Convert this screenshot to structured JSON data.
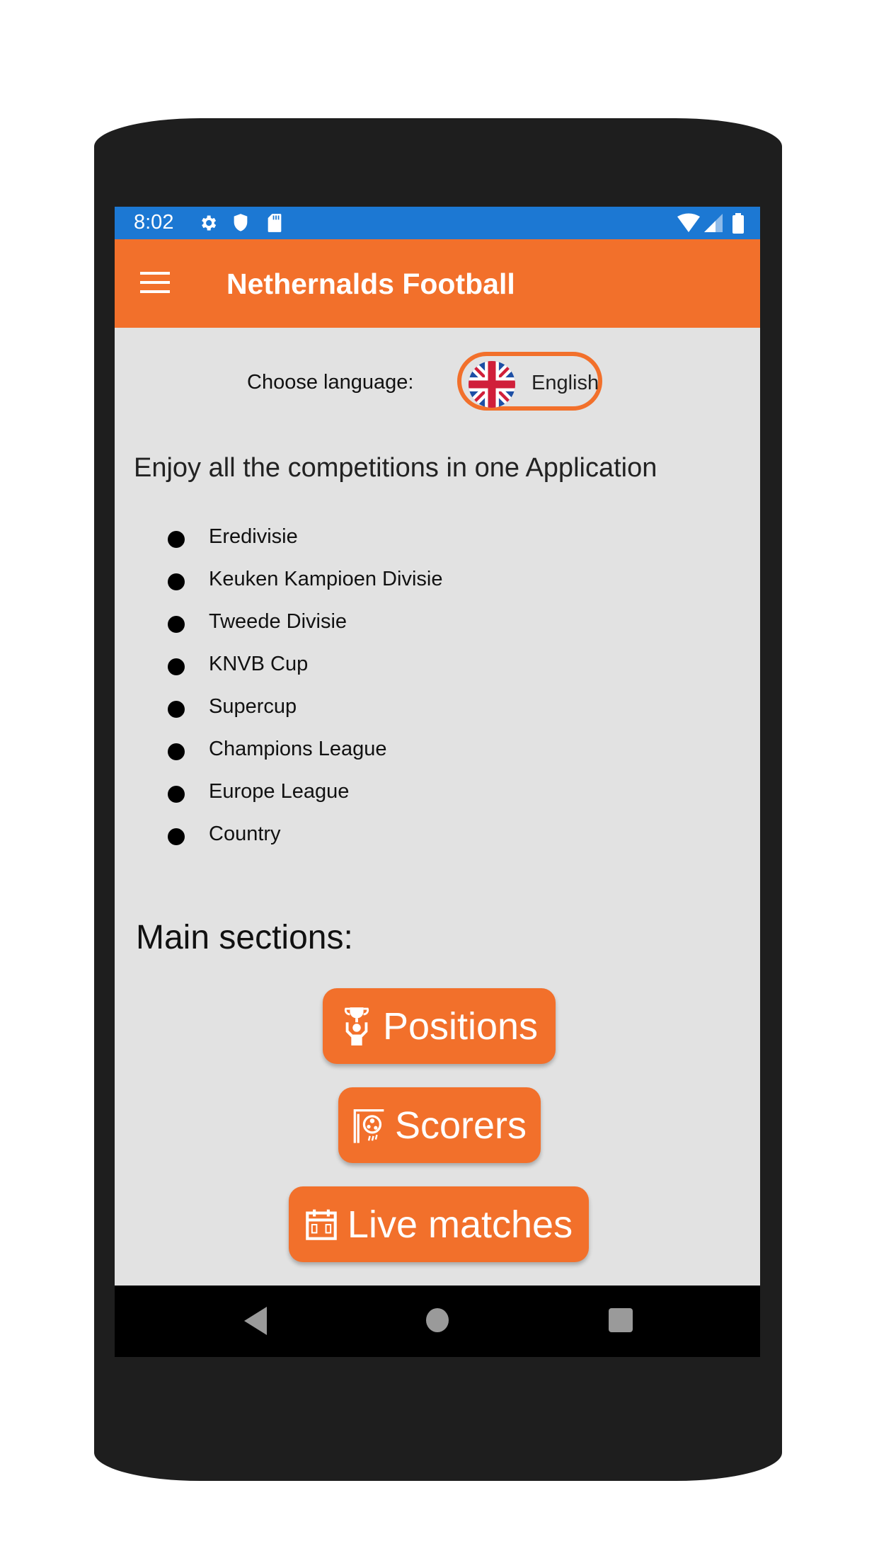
{
  "status_bar": {
    "time": "8:02",
    "left_icons": [
      "gear-icon",
      "shield-icon",
      "sd-card-icon"
    ],
    "right_icons": [
      "wifi-icon",
      "signal-icon",
      "battery-icon"
    ],
    "color": "#1c78d3"
  },
  "app_bar": {
    "title": "Nethernalds Football",
    "menu_icon": "hamburger-menu-icon",
    "color": "#f2702b"
  },
  "language": {
    "label": "Choose language:",
    "selected": "English",
    "flag_icon": "uk-flag-icon"
  },
  "tagline": "Enjoy all the competitions in one Application",
  "competitions": [
    "Eredivisie",
    "Keuken Kampioen Divisie",
    "Tweede Divisie",
    "KNVB Cup",
    "Supercup",
    "Champions League",
    "Europe League",
    "Country"
  ],
  "main_sections": {
    "title": "Main sections:",
    "buttons": [
      {
        "label": "Positions",
        "icon": "trophy-icon"
      },
      {
        "label": "Scorers",
        "icon": "goal-ball-icon"
      },
      {
        "label": "Live matches",
        "icon": "scoreboard-calendar-icon"
      }
    ]
  },
  "nav_bar": {
    "buttons": [
      "back",
      "home",
      "recents"
    ]
  }
}
